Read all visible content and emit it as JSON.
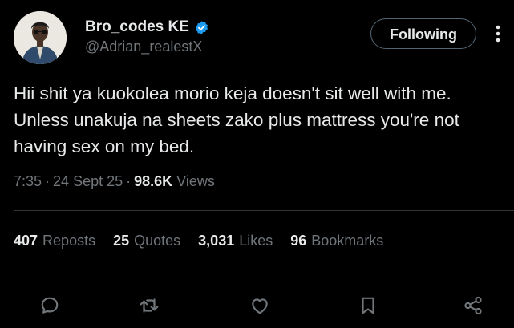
{
  "author": {
    "display_name": "Bro_codes KE",
    "handle": "@Adrian_realestX",
    "verified_badge_color": "#1d9bf0"
  },
  "follow_button": {
    "label": "Following"
  },
  "more_icon": "more-vertical-icon",
  "tweet": {
    "text": "Hii shit ya kuokolea morio keja doesn't sit well with me. Unless unakuja na sheets zako plus mattress you're not having sex on my bed."
  },
  "meta": {
    "time": "7:35",
    "separator": "·",
    "date": "24 Sept 25",
    "views_count": "98.6K",
    "views_label": "Views"
  },
  "stats": {
    "reposts": {
      "count": "407",
      "label": "Reposts"
    },
    "quotes": {
      "count": "25",
      "label": "Quotes"
    },
    "likes": {
      "count": "3,031",
      "label": "Likes"
    },
    "bookmarks": {
      "count": "96",
      "label": "Bookmarks"
    }
  },
  "actions": [
    "reply-icon",
    "repost-icon",
    "like-icon",
    "bookmark-icon",
    "share-icon"
  ],
  "colors": {
    "background": "#000000",
    "primary_text": "#e7e9ea",
    "secondary_text": "#71767b",
    "divider": "#2f3336"
  }
}
